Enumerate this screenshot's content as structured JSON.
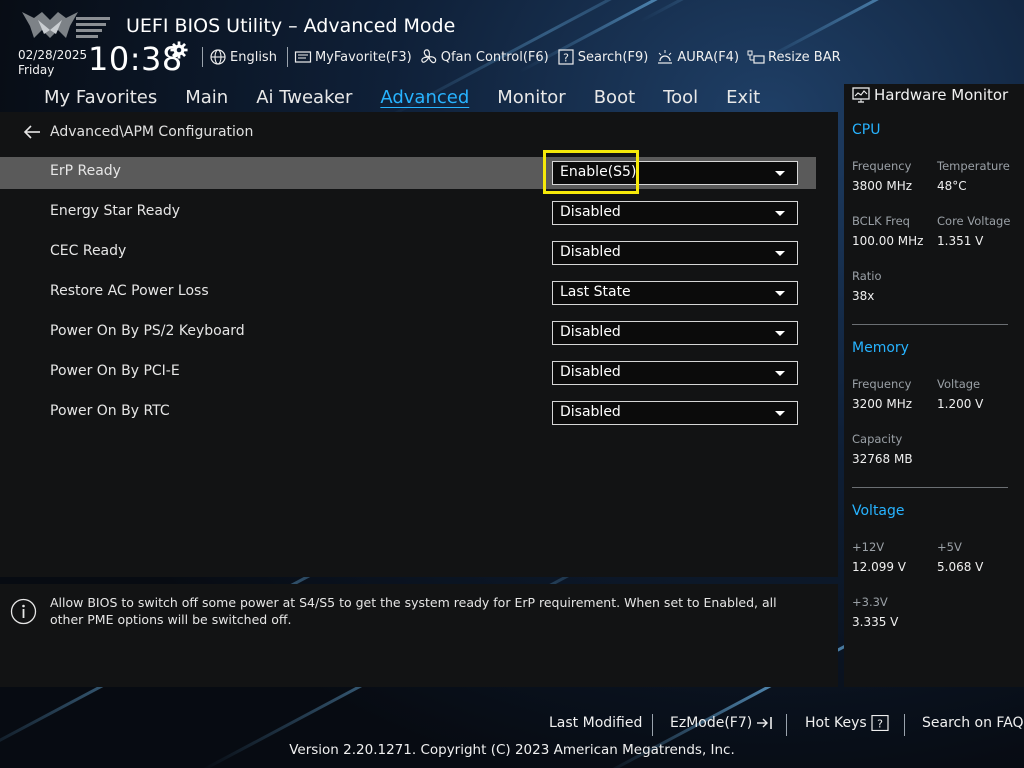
{
  "header": {
    "title": "UEFI BIOS Utility – Advanced Mode",
    "date": "02/28/2025",
    "weekday": "Friday",
    "time": "10:38",
    "top_menu": [
      {
        "label": "English",
        "icon": "globe-icon"
      },
      {
        "label": "MyFavorite(F3)",
        "icon": "favorite-icon"
      },
      {
        "label": "Qfan Control(F6)",
        "icon": "fan-icon"
      },
      {
        "label": "Search(F9)",
        "icon": "search-help-icon"
      },
      {
        "label": "AURA(F4)",
        "icon": "aura-icon"
      },
      {
        "label": "Resize BAR",
        "icon": "resize-bar-icon"
      }
    ]
  },
  "nav": {
    "tabs": [
      "My Favorites",
      "Main",
      "Ai Tweaker",
      "Advanced",
      "Monitor",
      "Boot",
      "Tool",
      "Exit"
    ],
    "active": "Advanced"
  },
  "breadcrumb": "Advanced\\APM Configuration",
  "settings": [
    {
      "label": "ErP Ready",
      "value": "Enable(S5)"
    },
    {
      "label": "Energy Star Ready",
      "value": "Disabled"
    },
    {
      "label": "CEC Ready",
      "value": "Disabled"
    },
    {
      "label": "Restore AC Power Loss",
      "value": "Last State"
    },
    {
      "label": "Power On By PS/2 Keyboard",
      "value": "Disabled"
    },
    {
      "label": "Power On By PCI-E",
      "value": "Disabled"
    },
    {
      "label": "Power On By RTC",
      "value": "Disabled"
    }
  ],
  "help_text": "Allow BIOS to switch off some power at S4/S5 to get the system ready for ErP requirement. When set to Enabled, all other PME options will be switched off.",
  "hardware_monitor": {
    "title": "Hardware Monitor",
    "cpu": {
      "title": "CPU",
      "frequency_label": "Frequency",
      "frequency": "3800 MHz",
      "temperature_label": "Temperature",
      "temperature": "48°C",
      "bclk_label": "BCLK Freq",
      "bclk": "100.00 MHz",
      "core_voltage_label": "Core Voltage",
      "core_voltage": "1.351 V",
      "ratio_label": "Ratio",
      "ratio": "38x"
    },
    "memory": {
      "title": "Memory",
      "frequency_label": "Frequency",
      "frequency": "3200 MHz",
      "voltage_label": "Voltage",
      "voltage": "1.200 V",
      "capacity_label": "Capacity",
      "capacity": "32768 MB"
    },
    "voltage": {
      "title": "Voltage",
      "v12_label": "+12V",
      "v12": "12.099 V",
      "v5_label": "+5V",
      "v5": "5.068 V",
      "v33_label": "+3.3V",
      "v33": "3.335 V"
    }
  },
  "footer": {
    "last_modified": "Last Modified",
    "ezmode": "EzMode(F7)",
    "hot_keys": "Hot Keys",
    "search_faq": "Search on FAQ",
    "copyright": "Version 2.20.1271. Copyright (C) 2023 American Megatrends, Inc."
  },
  "colors": {
    "accent": "#27b3ff",
    "focus": "#f5e90a",
    "selected_row": "#5a5a5a",
    "panel": "#121314"
  }
}
